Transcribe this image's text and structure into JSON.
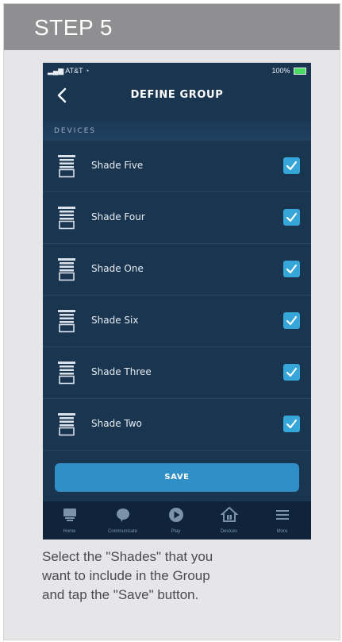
{
  "step": {
    "title": "STEP 5"
  },
  "status_bar": {
    "carrier": "AT&T",
    "battery": "100%"
  },
  "nav": {
    "title": "DEFINE GROUP",
    "back_icon": "chevron-left-icon"
  },
  "section": {
    "label": "DEVICES"
  },
  "devices": [
    {
      "label": "Shade Five",
      "checked": true
    },
    {
      "label": "Shade Four",
      "checked": true
    },
    {
      "label": "Shade One",
      "checked": true
    },
    {
      "label": "Shade Six",
      "checked": true
    },
    {
      "label": "Shade Three",
      "checked": true
    },
    {
      "label": "Shade Two",
      "checked": true
    }
  ],
  "save_button": {
    "label": "SAVE"
  },
  "tabs": [
    {
      "label": "Home",
      "icon": "home-icon"
    },
    {
      "label": "Communicate",
      "icon": "chat-bubble-icon"
    },
    {
      "label": "Play",
      "icon": "play-icon"
    },
    {
      "label": "Devices",
      "icon": "devices-house-icon"
    },
    {
      "label": "More",
      "icon": "menu-icon"
    }
  ],
  "caption": {
    "line1": "Select the \"Shades\" that you",
    "line2": "want to include in the Group",
    "line3": "and tap the \"Save\" button."
  },
  "colors": {
    "header_bg": "#8f8f92",
    "app_bg": "#1a3550",
    "accent": "#36a5d8",
    "save_button": "#2f8fc6"
  }
}
